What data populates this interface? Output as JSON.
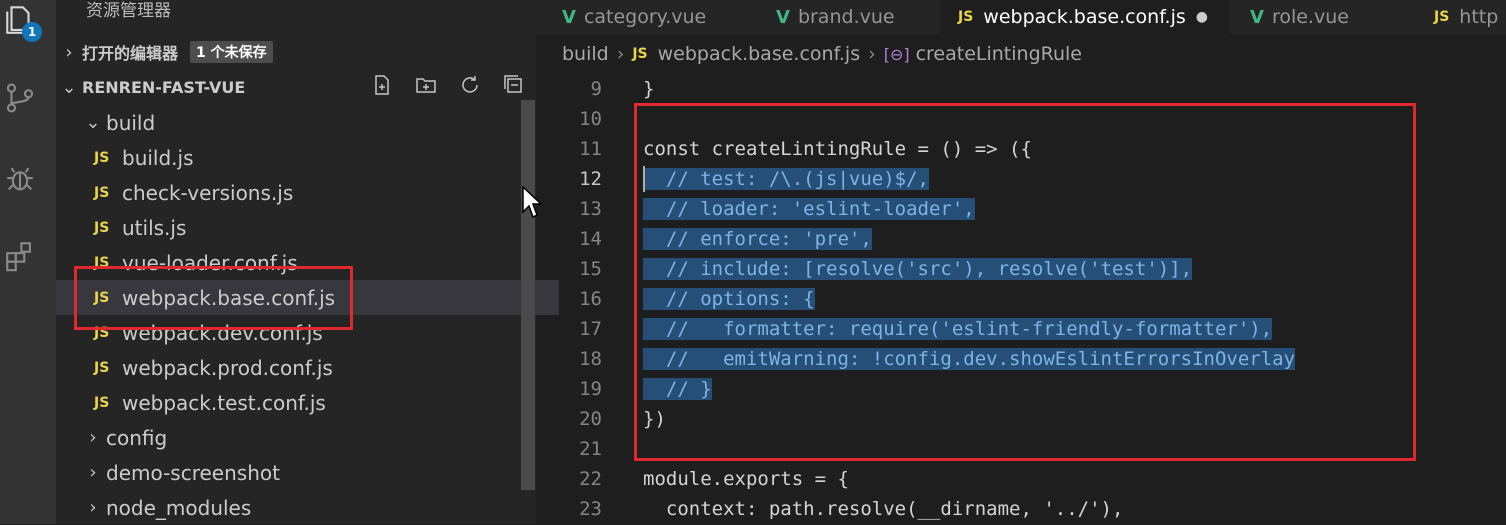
{
  "activity_bar": {
    "badge_count": "1"
  },
  "sidebar": {
    "title": "资源管理器",
    "open_editors": {
      "label": "打开的编辑器",
      "unsaved": "1 个未保存"
    },
    "project": {
      "name": "RENREN-FAST-VUE"
    },
    "tree": [
      {
        "type": "folder",
        "label": "build",
        "expanded": true
      },
      {
        "type": "js",
        "label": "build.js"
      },
      {
        "type": "js",
        "label": "check-versions.js"
      },
      {
        "type": "js",
        "label": "utils.js"
      },
      {
        "type": "js",
        "label": "vue-loader.conf.js"
      },
      {
        "type": "js",
        "label": "webpack.base.conf.js",
        "selected": true
      },
      {
        "type": "js",
        "label": "webpack.dev.conf.js"
      },
      {
        "type": "js",
        "label": "webpack.prod.conf.js"
      },
      {
        "type": "js",
        "label": "webpack.test.conf.js"
      },
      {
        "type": "folder",
        "label": "config",
        "expanded": false
      },
      {
        "type": "folder",
        "label": "demo-screenshot",
        "expanded": false
      },
      {
        "type": "folder",
        "label": "node_modules",
        "expanded": false
      }
    ]
  },
  "tabs": [
    {
      "icon": "vue",
      "label": "category.vue"
    },
    {
      "icon": "vue",
      "label": "brand.vue"
    },
    {
      "icon": "js",
      "label": "webpack.base.conf.js",
      "active": true,
      "modified": "●"
    },
    {
      "icon": "vue",
      "label": "role.vue"
    },
    {
      "icon": "js",
      "label": "http"
    }
  ],
  "breadcrumb": {
    "folder": "build",
    "file_icon": "JS",
    "file": "webpack.base.conf.js",
    "symbol_icon": "[⊖]",
    "symbol": "createLintingRule"
  },
  "code": {
    "lines": [
      {
        "n": "9",
        "text": "}"
      },
      {
        "n": "10",
        "text": ""
      },
      {
        "n": "11",
        "text": "const createLintingRule = () => ({"
      },
      {
        "n": "12",
        "text": "  // test: /\\.(js|vue)$/,"
      },
      {
        "n": "13",
        "text": "  // loader: 'eslint-loader',"
      },
      {
        "n": "14",
        "text": "  // enforce: 'pre',"
      },
      {
        "n": "15",
        "text": "  // include: [resolve('src'), resolve('test')],"
      },
      {
        "n": "16",
        "text": "  // options: {"
      },
      {
        "n": "17",
        "text": "  //   formatter: require('eslint-friendly-formatter'),"
      },
      {
        "n": "18",
        "text": "  //   emitWarning: !config.dev.showEslintErrorsInOverlay"
      },
      {
        "n": "19",
        "text": "  // }"
      },
      {
        "n": "20",
        "text": "})"
      },
      {
        "n": "21",
        "text": ""
      },
      {
        "n": "22",
        "text": "module.exports = {"
      },
      {
        "n": "23",
        "text": "  context: path.resolve(__dirname, '../'),"
      }
    ]
  },
  "colors": {
    "accent": "#1177bb",
    "annotation_box": "#e0282f",
    "js_icon": "#e8d44d",
    "vue_icon": "#41b883",
    "selection": "#264f78"
  }
}
